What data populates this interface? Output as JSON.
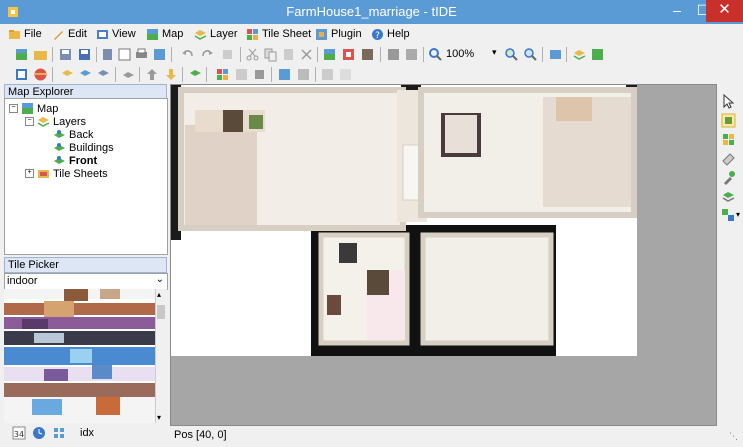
{
  "window": {
    "title": "FarmHouse1_marriage - tIDE",
    "minimize": "–",
    "maximize": "☐",
    "close": "✕"
  },
  "menu": [
    {
      "label": "File",
      "icon": "folder-icon"
    },
    {
      "label": "Edit",
      "icon": "pencil-icon"
    },
    {
      "label": "View",
      "icon": "view-icon"
    },
    {
      "label": "Map",
      "icon": "map-icon"
    },
    {
      "label": "Layer",
      "icon": "layer-icon"
    },
    {
      "label": "Tile Sheet",
      "icon": "tilesheet-icon"
    },
    {
      "label": "Plugin",
      "icon": "plugin-icon"
    },
    {
      "label": "Help",
      "icon": "help-icon"
    }
  ],
  "toolbar": {
    "zoom": "100%"
  },
  "map_explorer": {
    "header": "Map Explorer",
    "root": "Map",
    "layers_label": "Layers",
    "layers": [
      "Back",
      "Buildings",
      "Front"
    ],
    "selected_layer": "Front",
    "tilesheets_label": "Tile Sheets"
  },
  "tile_picker": {
    "header": "Tile Picker",
    "selected_sheet": "indoor",
    "footer_label": "idx"
  },
  "status": {
    "pos": "Pos [40, 0]"
  },
  "colors": {
    "titlebar": "#5b9bd5",
    "close": "#c9302c",
    "panel_header": "#dce6f4",
    "canvas_bg": "#a6a6a6"
  }
}
